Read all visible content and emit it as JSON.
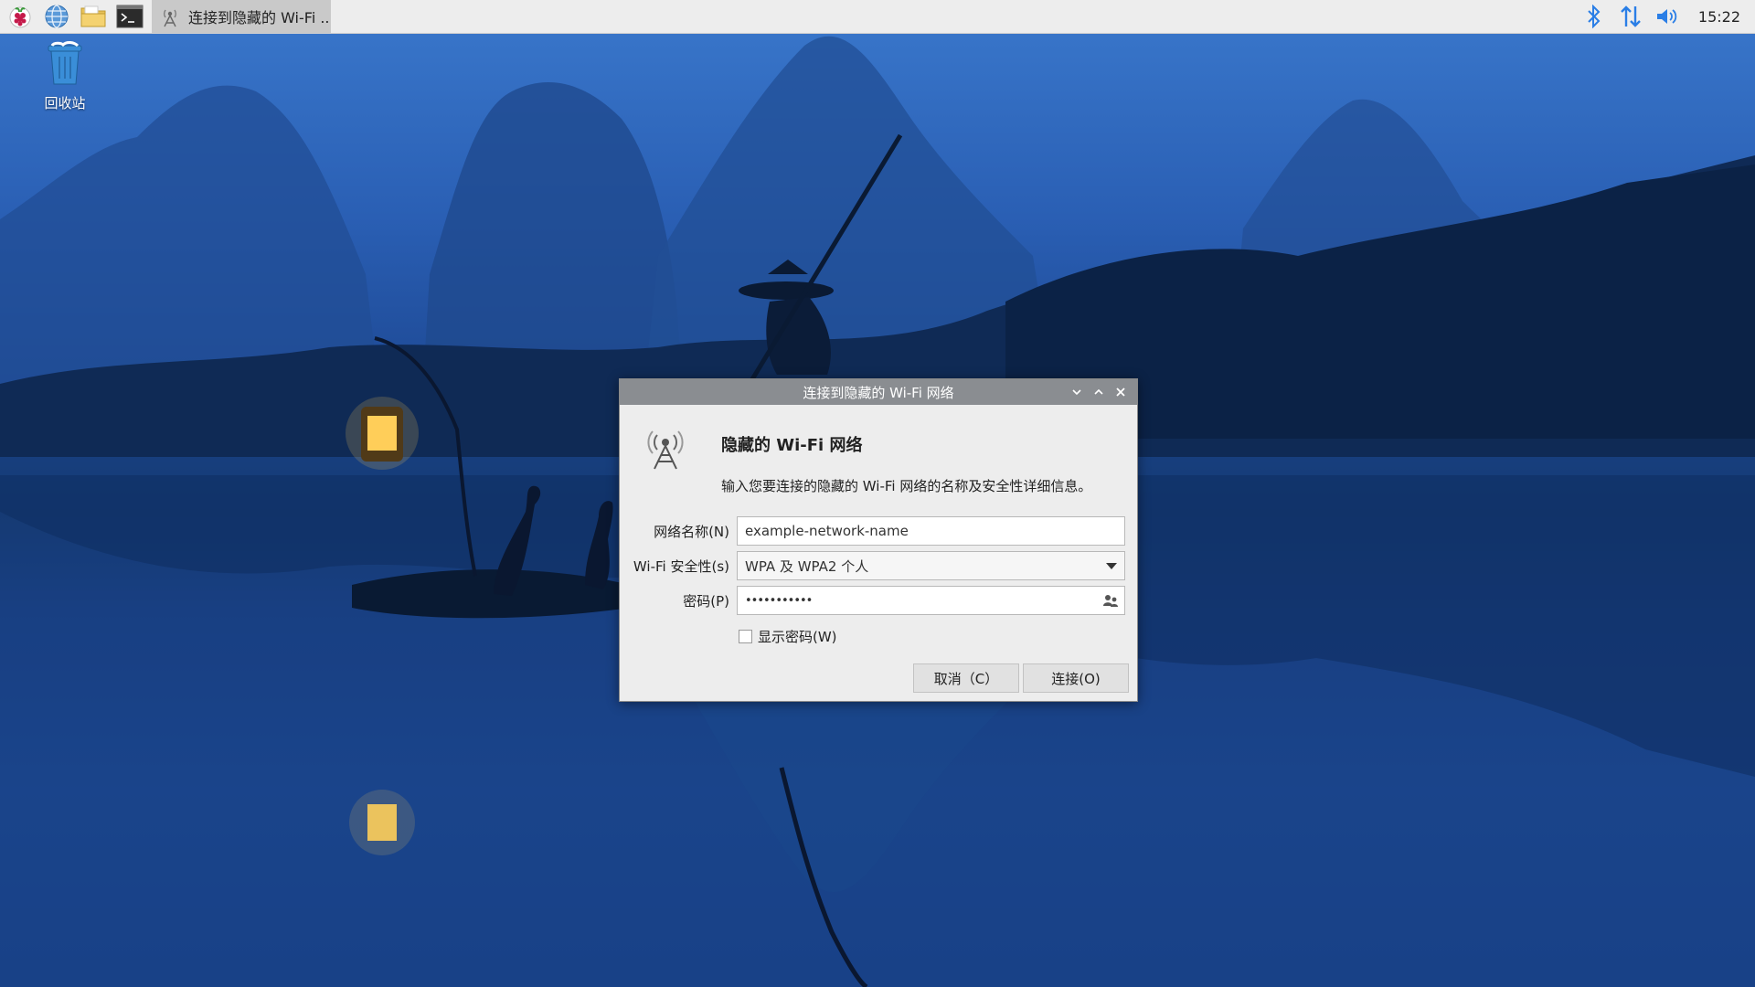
{
  "taskbar": {
    "launchers": [
      "raspberry-menu",
      "web-browser",
      "file-manager",
      "terminal"
    ],
    "task_title": "连接到隐藏的 Wi-Fi ...",
    "tray": [
      "bluetooth",
      "network",
      "volume"
    ],
    "clock": "15:22"
  },
  "desktop": {
    "trash_label": "回收站"
  },
  "dialog": {
    "title": "连接到隐藏的 Wi-Fi 网络",
    "heading": "隐藏的 Wi-Fi 网络",
    "description": "输入您要连接的隐藏的 Wi-Fi 网络的名称及安全性详细信息。",
    "network_name_label": "网络名称(N)",
    "network_name_value": "example-network-name",
    "security_label": "Wi-Fi 安全性(s)",
    "security_value": "WPA 及 WPA2 个人",
    "password_label": "密码(P)",
    "password_value": "•••••••••••",
    "show_password_label": "显示密码(W)",
    "show_password_checked": false,
    "cancel_label": "取消（C）",
    "connect_label": "连接(O)"
  },
  "colors": {
    "titlebar": "#8a8d91",
    "taskbar": "#ededed",
    "dialog_bg": "#ededed",
    "tray_accent": "#2a7ee6"
  }
}
